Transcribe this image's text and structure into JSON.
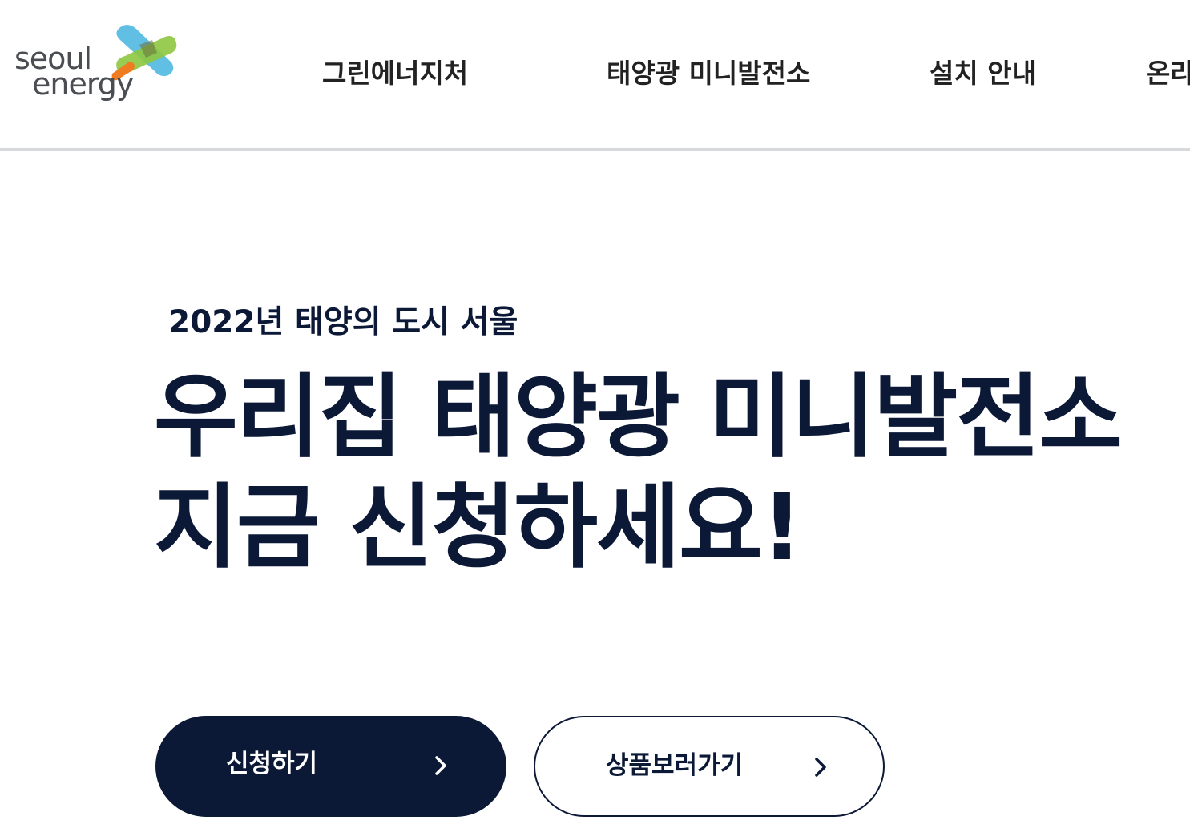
{
  "brand": {
    "logo_line1": "seoul",
    "logo_line2": "energy"
  },
  "nav": {
    "items": [
      {
        "label": "그린에너지처"
      },
      {
        "label": "태양광 미니발전소"
      },
      {
        "label": "설치 안내"
      },
      {
        "label": "온라"
      }
    ]
  },
  "hero": {
    "subtitle": "2022년 태양의 도시 서울",
    "headline_line1": "우리집 태양광 미니발전소",
    "headline_line2": "지금 신청하세요!"
  },
  "buttons": {
    "apply_label": "신청하기",
    "products_label": "상품보러가기",
    "icon": "chevron-right-icon"
  },
  "colors": {
    "primary": "#0b1836",
    "divider": "#d7d9dc",
    "logo_green": "#8dc63f",
    "logo_blue": "#4fb8e0",
    "logo_orange": "#f07c22"
  }
}
